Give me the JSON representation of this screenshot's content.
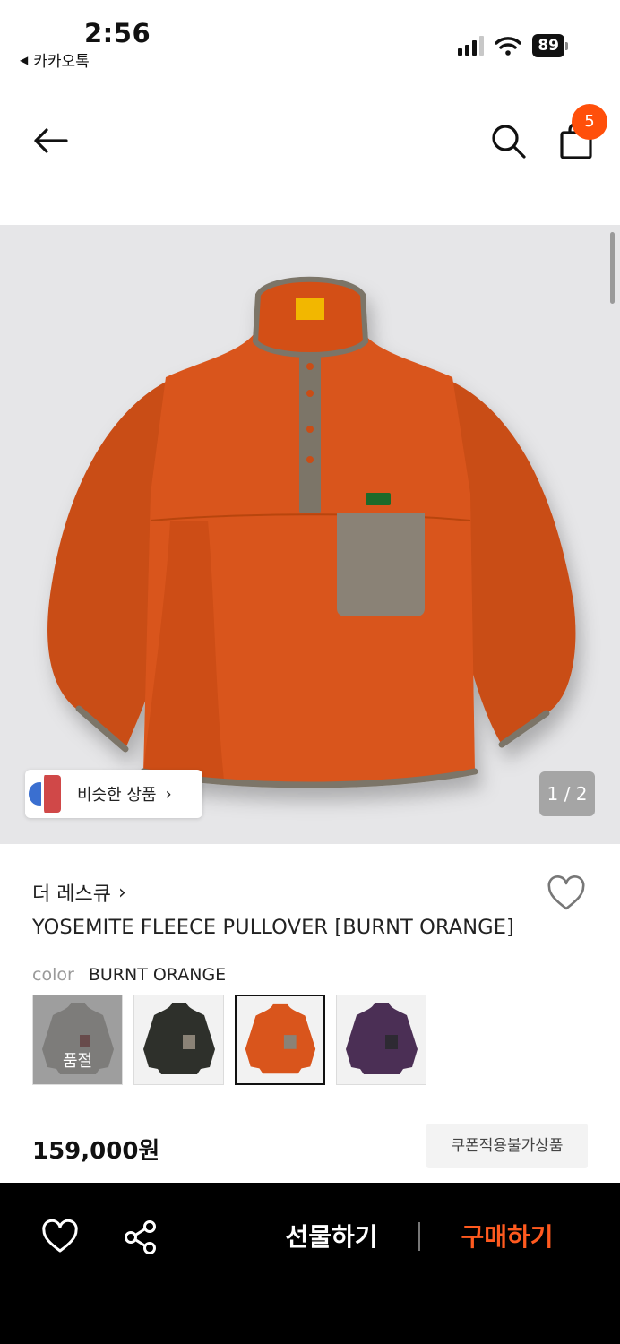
{
  "status_bar": {
    "time": "2:56",
    "back_app_label": "카카오톡",
    "battery": "89"
  },
  "nav": {
    "cart_count": "5",
    "icons": [
      "back-arrow-icon",
      "search-icon",
      "shopping-bag-icon"
    ]
  },
  "hero": {
    "similar_label": "비슷한 상품",
    "similar_chevron": "›",
    "page_indicator": "1 / 2",
    "jacket_color": "#d9551c",
    "trim_color": "#7b7468"
  },
  "product": {
    "brand": "더 레스큐",
    "brand_chevron": "›",
    "name": "YOSEMITE FLEECE PULLOVER [BURNT ORANGE]",
    "color_label": "color",
    "color_value": "BURNT ORANGE",
    "swatches": [
      {
        "color": "#a8a6a3",
        "status": "품절"
      },
      {
        "color": "#2e302b",
        "status": ""
      },
      {
        "color": "#d9551c",
        "status": ""
      },
      {
        "color": "#4b2f55",
        "status": ""
      }
    ],
    "price": "159,000원",
    "coupon_tag": "쿠폰적용불가상품"
  },
  "bottom_bar": {
    "gift_label": "선물하기",
    "buy_label": "구매하기",
    "accent": "#ff5a1f"
  }
}
